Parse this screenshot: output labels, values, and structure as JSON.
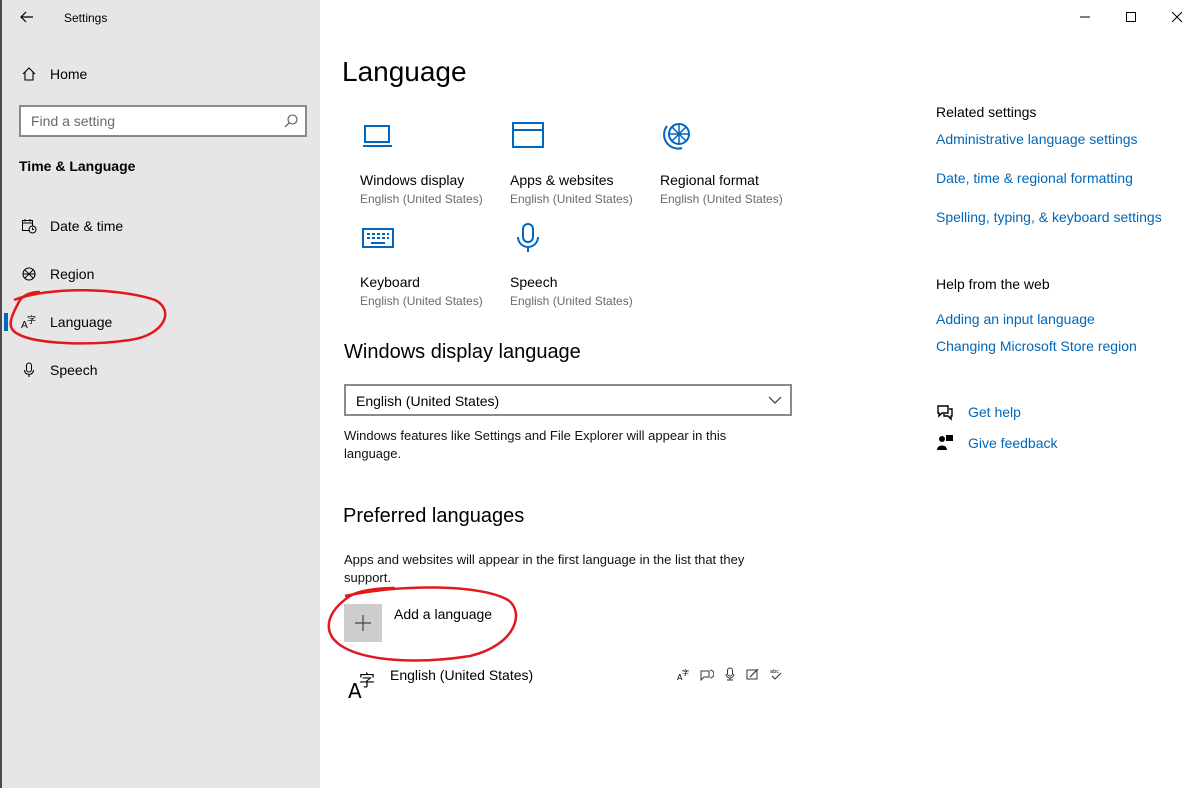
{
  "window": {
    "title": "Settings",
    "controls": [
      "minimize-icon",
      "maximize-icon",
      "close-icon"
    ]
  },
  "sidebar": {
    "home_label": "Home",
    "search_placeholder": "Find a setting",
    "section_title": "Time & Language",
    "items": [
      {
        "label": "Date & time",
        "icon": "calendar-clock-icon",
        "selected": false
      },
      {
        "label": "Region",
        "icon": "globe-icon",
        "selected": false
      },
      {
        "label": "Language",
        "icon": "language-icon",
        "selected": true
      },
      {
        "label": "Speech",
        "icon": "microphone-icon",
        "selected": false
      }
    ]
  },
  "main": {
    "title": "Language",
    "tiles": [
      {
        "label": "Windows display",
        "sub": "English (United States)",
        "icon": "monitor-icon"
      },
      {
        "label": "Apps & websites",
        "sub": "English (United States)",
        "icon": "browser-window-icon"
      },
      {
        "label": "Regional format",
        "sub": "English (United States)",
        "icon": "globe-icon"
      },
      {
        "label": "Keyboard",
        "sub": "English (United States)",
        "icon": "keyboard-icon"
      },
      {
        "label": "Speech",
        "sub": "English (United States)",
        "icon": "microphone-icon"
      }
    ],
    "display_language": {
      "heading": "Windows display language",
      "selected": "English (United States)",
      "description": "Windows features like Settings and File Explorer will appear in this language."
    },
    "preferred": {
      "heading": "Preferred languages",
      "description": "Apps and websites will appear in the first language in the list that they support.",
      "add_label": "Add a language",
      "languages": [
        {
          "name": "English (United States)",
          "features": [
            "language-pack-icon",
            "text-to-speech-icon",
            "speech-recognition-icon",
            "handwriting-icon",
            "spellcheck-icon"
          ]
        }
      ]
    }
  },
  "right": {
    "related_heading": "Related settings",
    "related_links": [
      "Administrative language settings",
      "Date, time & regional formatting",
      "Spelling, typing, & keyboard settings"
    ],
    "help_heading": "Help from the web",
    "help_links": [
      "Adding an input language",
      "Changing Microsoft Store region"
    ],
    "get_help": "Get help",
    "give_feedback": "Give feedback"
  },
  "colors": {
    "accent": "#0067c0",
    "link": "#0067b8",
    "sidebar_bg": "#e6e6e6",
    "annotation": "#e0191b"
  }
}
